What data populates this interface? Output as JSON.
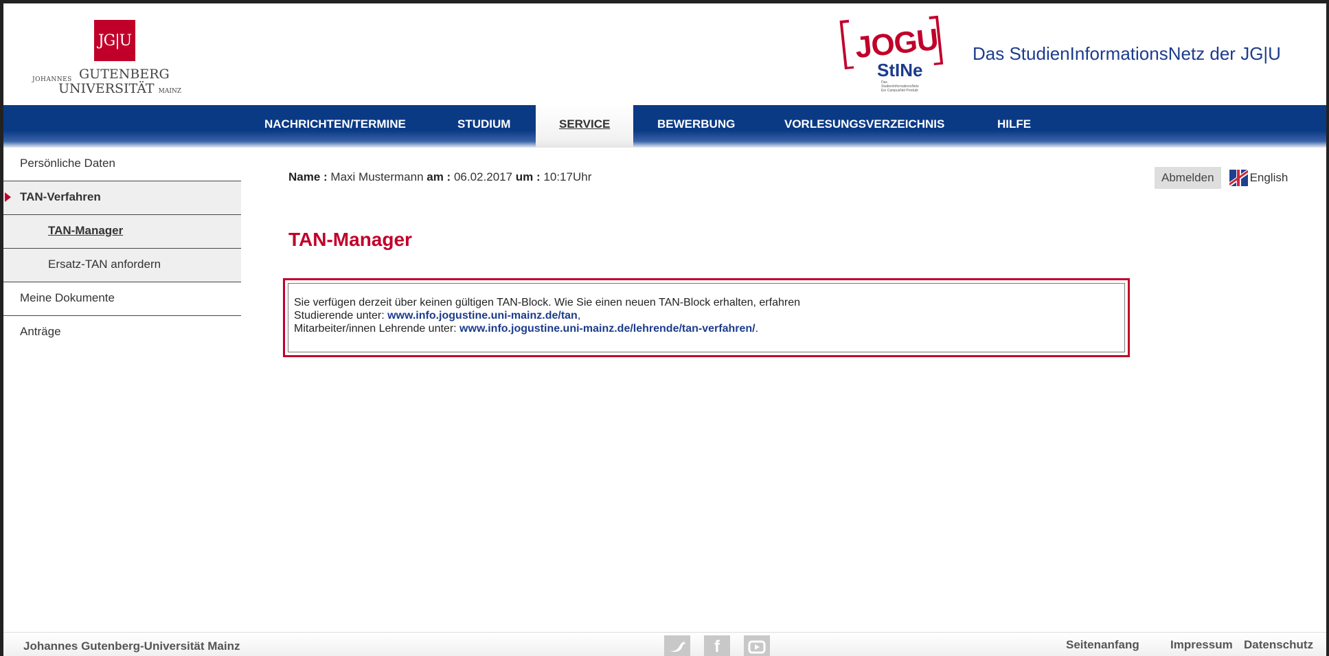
{
  "header": {
    "university_logo": {
      "box_text": "JG|U",
      "line_small": "JOHANNES",
      "line1": "GUTENBERG",
      "line2": "UNIVERSITÄT",
      "line2_suffix": "MAINZ"
    },
    "stine_logo": {
      "jogu": "JOGU",
      "stine": "StINe",
      "sub": "Das StudienInformationsNetz Ein CampusNet Produkt"
    },
    "tagline": "Das StudienInformationsNetz der JG|U"
  },
  "nav": {
    "items": [
      {
        "label": "NACHRICHTEN/TERMINE"
      },
      {
        "label": "STUDIUM"
      },
      {
        "label": "SERVICE"
      },
      {
        "label": "BEWERBUNG"
      },
      {
        "label": "VORLESUNGSVERZEICHNIS"
      },
      {
        "label": "HILFE"
      }
    ],
    "active": "SERVICE"
  },
  "sidebar": {
    "items": [
      {
        "label": "Persönliche Daten"
      },
      {
        "label": "TAN-Verfahren"
      },
      {
        "label": "TAN-Manager"
      },
      {
        "label": "Ersatz-TAN anfordern"
      },
      {
        "label": "Meine Dokumente"
      },
      {
        "label": "Anträge"
      }
    ]
  },
  "userline": {
    "name_label": "Name :",
    "name_value": "Maxi Mustermann",
    "date_label": "am :",
    "date_value": "06.02.2017",
    "time_label": "um :",
    "time_value": "10:17Uhr"
  },
  "actions": {
    "logout_label": "Abmelden",
    "language_label": "English"
  },
  "main": {
    "title": "TAN-Manager",
    "message": {
      "line1": "Sie verfügen derzeit über keinen gültigen TAN-Block. Wie Sie einen neuen TAN-Block erhalten, erfahren",
      "line2_prefix": "Studierende unter: ",
      "line2_link": "www.info.jogustine.uni-mainz.de/tan",
      "line2_suffix": ",",
      "line3_prefix": "Mitarbeiter/innen Lehrende unter: ",
      "line3_link": "www.info.jogustine.uni-mainz.de/lehrende/tan-verfahren/",
      "line3_suffix": "."
    }
  },
  "footer": {
    "university": "Johannes Gutenberg-Universität Mainz",
    "links": [
      "Seitenanfang",
      "Impressum",
      "Datenschutz"
    ],
    "social": [
      "twitter",
      "facebook",
      "youtube"
    ]
  },
  "colors": {
    "brand_red": "#c1002a",
    "nav_blue": "#0b3a85",
    "link_blue": "#1c3c8c"
  }
}
